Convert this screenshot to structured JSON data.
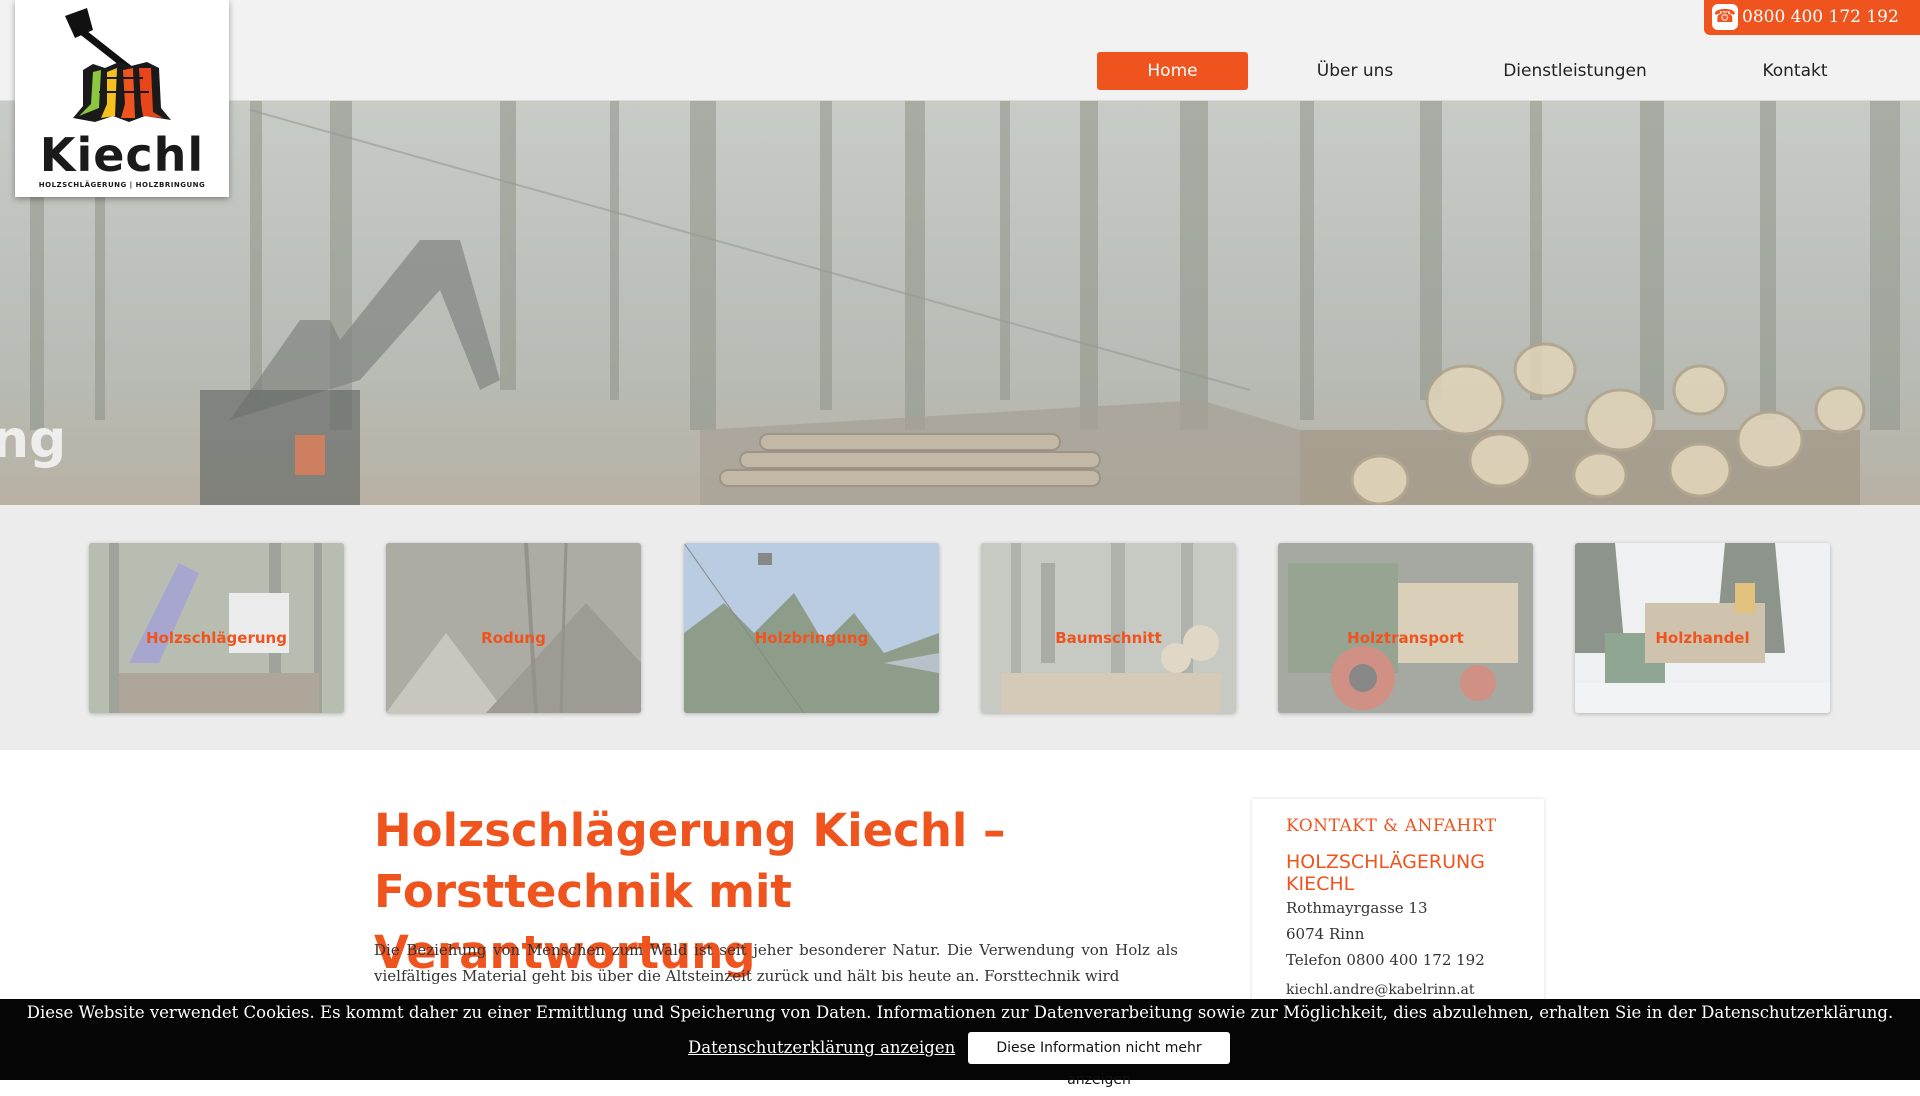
{
  "header": {
    "logo": {
      "brand": "Kiechl",
      "tagline": "HOLZSCHLÄGERUNG | HOLZBRINGUNG"
    },
    "phone": {
      "icon": "phone-icon",
      "number": "0800 400 172 192"
    },
    "nav": [
      {
        "label": "Home",
        "active": true
      },
      {
        "label": "Über uns",
        "active": false
      },
      {
        "label": "Dienstleistungen",
        "active": false
      },
      {
        "label": "Kontakt",
        "active": false
      }
    ]
  },
  "hero": {
    "caption_fragment": "ng"
  },
  "services": [
    {
      "label": "Holzschlägerung"
    },
    {
      "label": "Rodung"
    },
    {
      "label": "Holzbringung"
    },
    {
      "label": "Baumschnitt"
    },
    {
      "label": "Holztransport"
    },
    {
      "label": "Holzhandel"
    }
  ],
  "main": {
    "title": "Holzschlägerung Kiechl – Forsttechnik mit Verantwortung",
    "paragraph": "Die Beziehung von Menschen zum Wald ist seit jeher besonderer Natur. Die Verwendung von Holz als vielfältiges Material geht bis über die Altsteinzeit zurück und hält bis heute an. Forsttechnik wird"
  },
  "sidebar": {
    "heading": "KONTAKT & ANFAHRT",
    "company": "HOLZSCHLÄGERUNG KIECHL",
    "street": "Rothmayrgasse 13",
    "city": "6074 Rinn",
    "phone": "Telefon 0800 400 172 192",
    "email": "kiechl.andre@kabelrinn.at"
  },
  "cookie": {
    "message": "Diese Website verwendet Cookies. Es kommt daher zu einer Ermittlung und Speicherung von Daten. Informationen zur Datenverarbeitung sowie zur Möglichkeit, dies abzulehnen, erhalten Sie in der Datenschutzerklärung.",
    "link": "Datenschutzerklärung anzeigen",
    "dismiss": "Diese Information nicht mehr anzeigen"
  },
  "colors": {
    "accent": "#f0541e",
    "header_bg": "#f2f2f2",
    "band_bg": "#ececec",
    "cookie_bg": "#050505"
  }
}
